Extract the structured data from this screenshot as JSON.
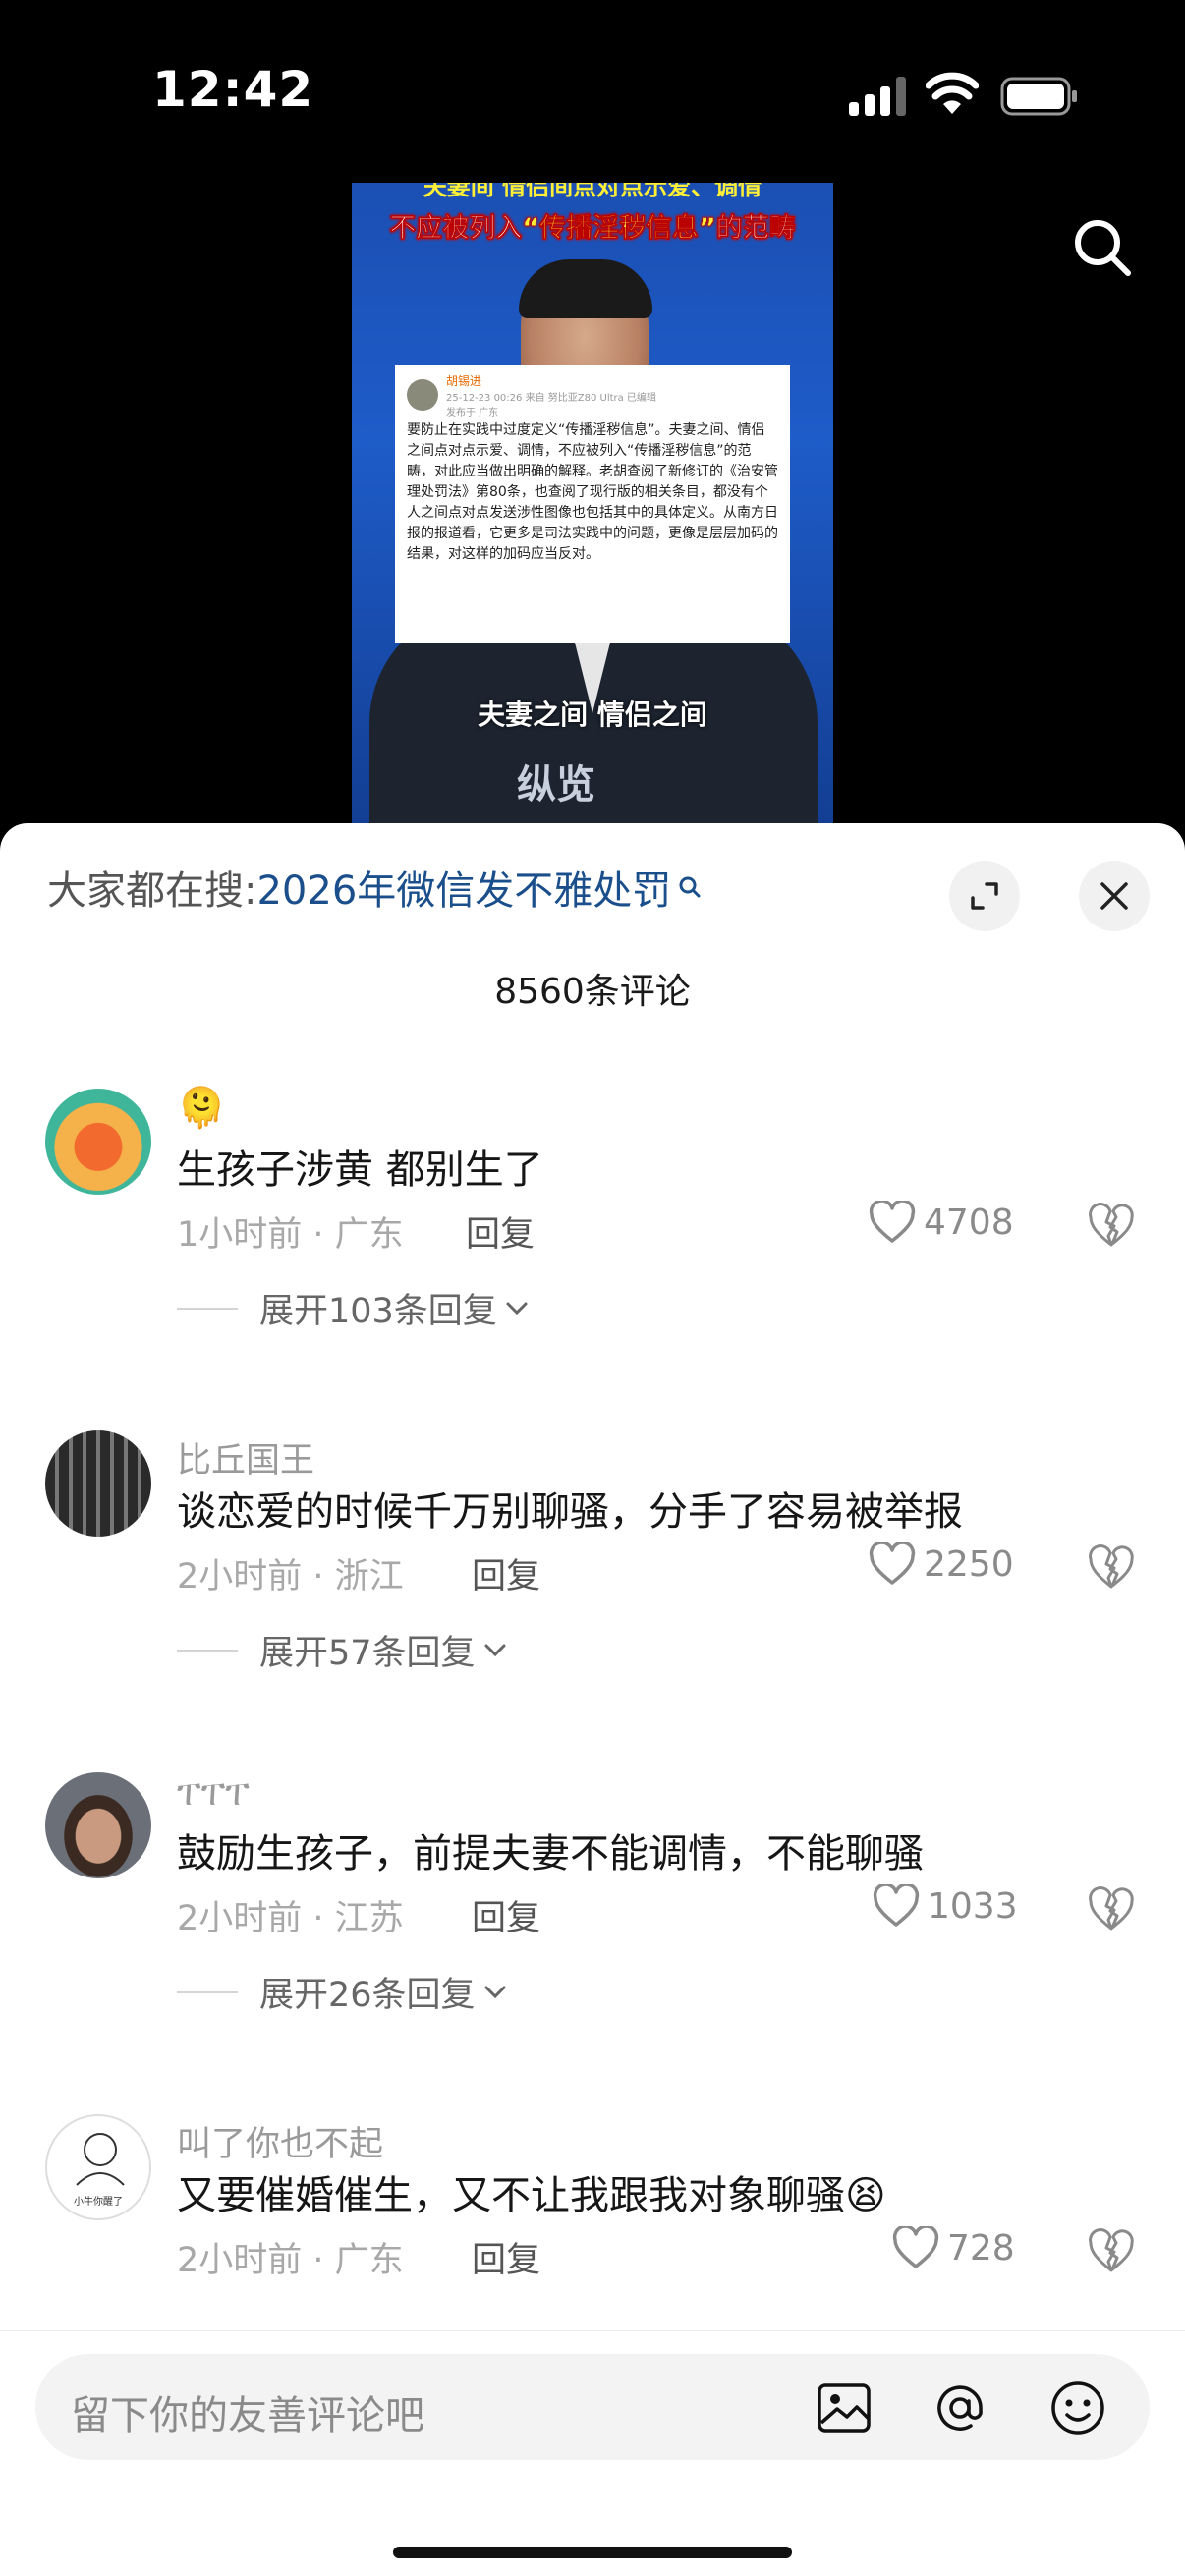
{
  "status": {
    "time": "12:42"
  },
  "video": {
    "headline_line1": "夫妻间 情侣间点对点示爱、调情",
    "headline_line2_a": "不应被列入",
    "headline_line2_b": "“传播淫秽信息”",
    "headline_line2_c": "的范畴",
    "weibo_name": "胡锡进",
    "weibo_meta": "25-12-23 00:26 来自 努比亚Z80 Ultra 已编辑",
    "weibo_location": "发布于 广东",
    "weibo_text": "要防止在实践中过度定义“传播淫秽信息”。夫妻之间、情侣之间点对点示爱、调情，不应被列入“传播淫秽信息”的范畴，对此应当做出明确的解释。老胡查阅了新修订的《治安管理处罚法》第80条，也查阅了现行版的相关条目，都没有个人之间点对点发送涉性图像也包括其中的具体定义。从南方日报的报道看，它更多是司法实践中的问题，更像是层层加码的结果，对这样的加码应当反对。",
    "caption": "夫妻之间 情侣之间",
    "logo": "纵览"
  },
  "sheet": {
    "hot_search_prefix": "大家都在搜:",
    "hot_search_query": "2026年微信发不雅处罚",
    "comment_count": "8560条评论"
  },
  "comments": [
    {
      "name": "",
      "emoji": "🫠",
      "text": "生孩子涉黄 都别生了",
      "time_loc": "1小时前 · 广东",
      "reply": "回复",
      "likes": "4708",
      "expand": "展开103条回复"
    },
    {
      "name": "比丘国王",
      "text": "谈恋爱的时候千万别聊骚，分手了容易被举报",
      "time_loc": "2小时前 · 浙江",
      "reply": "回复",
      "likes": "2250",
      "expand": "展开57条回复"
    },
    {
      "name": "ፐፐፐ",
      "text": "鼓励生孩子，前提夫妻不能调情，不能聊骚",
      "time_loc": "2小时前 · 江苏",
      "reply": "回复",
      "likes": "1033",
      "expand": "展开26条回复"
    },
    {
      "name": "叫了你也不起",
      "text": "又要催婚催生，又不让我跟我对象聊骚",
      "emoji": "😫",
      "time_loc": "2小时前 · 广东",
      "reply": "回复",
      "likes": "728",
      "avatar_text": "小牛你醒了"
    }
  ],
  "input": {
    "placeholder": "留下你的友善评论吧"
  }
}
